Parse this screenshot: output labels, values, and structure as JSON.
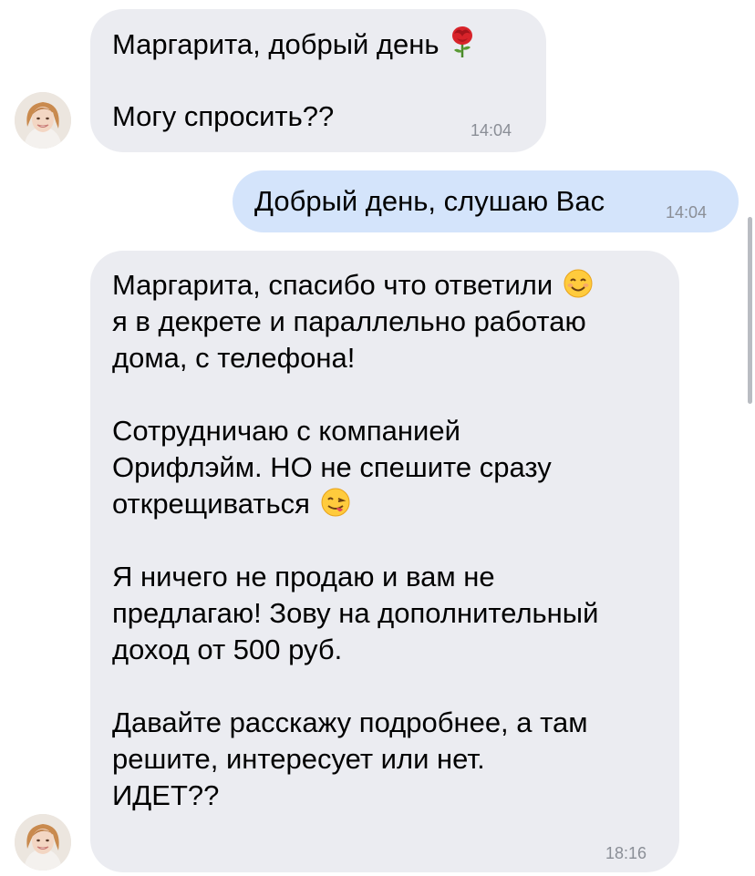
{
  "messages": [
    {
      "lines": [
        "Маргарита, добрый день",
        "",
        "Могу спросить??"
      ],
      "time": "14:04",
      "emoji": "rose"
    },
    {
      "lines": [
        "Добрый день, слушаю Вас"
      ],
      "time": "14:04"
    },
    {
      "lines": [
        "Маргарита, спасибо что ответили",
        "я в декрете и параллельно работаю",
        "дома, с телефона!",
        "",
        "Сотрудничаю с компанией",
        "Орифлэйм. НО не спешите сразу",
        "открещиваться",
        "",
        "Я ничего не продаю и вам не",
        "предлагаю! Зову на дополнительный",
        "доход от 500 руб.",
        "",
        "Давайте расскажу подробнее, а там",
        "решите, интересует или нет.",
        "ИДЕТ??"
      ],
      "time": "18:16",
      "emojis": [
        "smiling-face-icon",
        "yum-face-icon"
      ]
    }
  ],
  "colors": {
    "incoming_bubble": "#ebecf1",
    "outgoing_bubble": "#d4e4fb",
    "timestamp": "#8a8e96"
  }
}
